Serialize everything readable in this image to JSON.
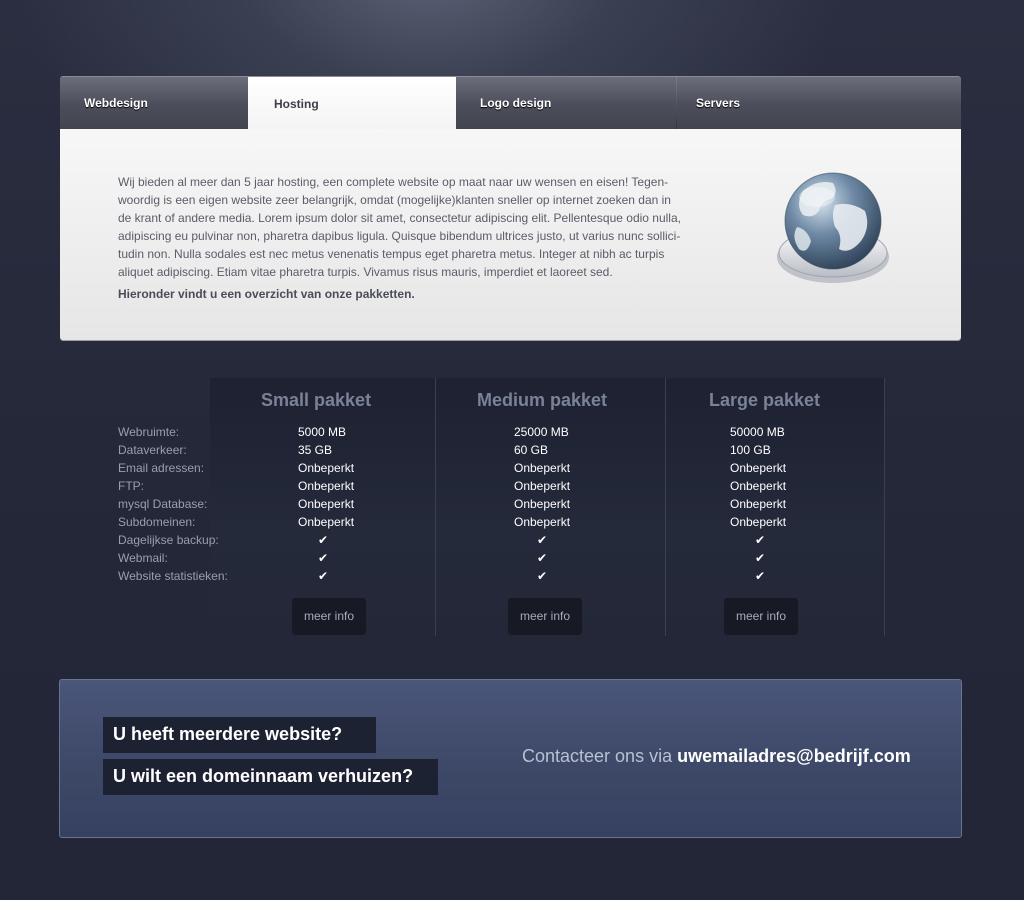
{
  "tabs": [
    "Webdesign",
    "Hosting",
    "Logo design",
    "Servers"
  ],
  "active_tab": "Hosting",
  "intro": {
    "lines": [
      "Wij bieden al meer dan 5 jaar hosting, een complete website op maat naar uw wensen en eisen! Tegen-",
      "woordig is een eigen website zeer belangrijk, omdat (mogelijke)klanten sneller op internet zoeken dan in",
      "de krant of andere media. Lorem ipsum dolor sit amet, consectetur adipiscing elit. Pellentesque odio nulla,",
      "adipiscing eu pulvinar non, pharetra dapibus ligula. Quisque bibendum ultrices justo, ut varius nunc sollici-",
      "tudin non. Nulla sodales est nec metus venenatis tempus eget pharetra metus. Integer at nibh ac turpis",
      "aliquet adipiscing. Etiam vitae pharetra turpis. Vivamus risus mauris, imperdiet et laoreet sed."
    ],
    "bold_line": "Hieronder vindt u een overzicht van onze pakketten.",
    "icon": "globe-icon"
  },
  "packages": {
    "row_labels": [
      "Webruimte:",
      "Dataverkeer:",
      "Email adressen:",
      "FTP:",
      "mysql Database:",
      "Subdomeinen:",
      "Dagelijkse backup:",
      "Webmail:",
      "Website statistieken:"
    ],
    "check_glyph": "✔",
    "items": [
      {
        "name": "Small pakket",
        "values": [
          "5000 MB",
          "35 GB",
          "Onbeperkt",
          "Onbeperkt",
          "Onbeperkt",
          "Onbeperkt"
        ],
        "checks": [
          true,
          true,
          true
        ],
        "button": "meer info"
      },
      {
        "name": "Medium pakket",
        "values": [
          "25000 MB",
          "60 GB",
          "Onbeperkt",
          "Onbeperkt",
          "Onbeperkt",
          "Onbeperkt"
        ],
        "checks": [
          true,
          true,
          true
        ],
        "button": "meer info"
      },
      {
        "name": "Large pakket",
        "values": [
          "50000 MB",
          "100 GB",
          "Onbeperkt",
          "Onbeperkt",
          "Onbeperkt",
          "Onbeperkt"
        ],
        "checks": [
          true,
          true,
          true
        ],
        "button": "meer info"
      }
    ]
  },
  "contact": {
    "question_1": "U heeft meerdere website?",
    "question_2": "U wilt een domeinnaam verhuizen?",
    "prefix": "Contacteer ons via ",
    "email": "uwemailadres@bedrijf.com"
  }
}
